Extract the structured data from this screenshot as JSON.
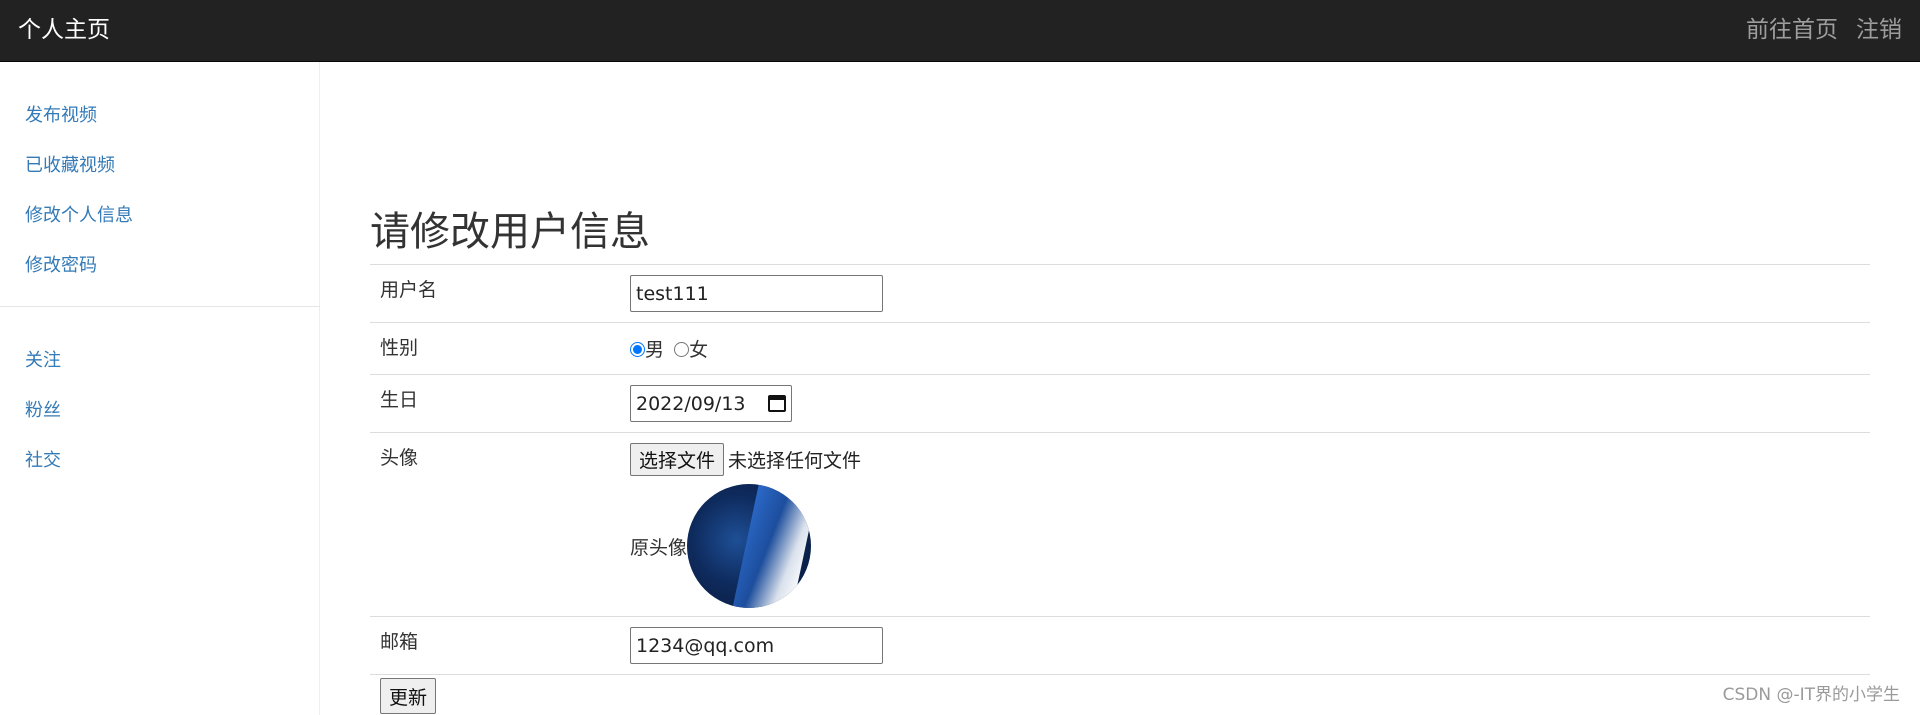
{
  "navbar": {
    "brand": "个人主页",
    "links": [
      "前往首页",
      "注销"
    ]
  },
  "sidebar": {
    "group1": [
      "发布视频",
      "已收藏视频",
      "修改个人信息",
      "修改密码"
    ],
    "group2": [
      "关注",
      "粉丝",
      "社交"
    ]
  },
  "form": {
    "title": "请修改用户信息",
    "username": {
      "label": "用户名",
      "value": "test111"
    },
    "gender": {
      "label": "性别",
      "options": [
        "男",
        "女"
      ],
      "selected": "男"
    },
    "birthday": {
      "label": "生日",
      "value": "2022/09/13"
    },
    "avatar": {
      "label": "头像",
      "choose_button": "选择文件",
      "file_status": "未选择任何文件",
      "original_label": "原头像"
    },
    "email": {
      "label": "邮箱",
      "value": "1234@qq.com"
    },
    "submit": "更新"
  },
  "watermark": "CSDN @-IT界的小学生",
  "colors": {
    "navbar_bg": "#222222",
    "link": "#337ab7",
    "radio_checked": "#0075ff"
  }
}
